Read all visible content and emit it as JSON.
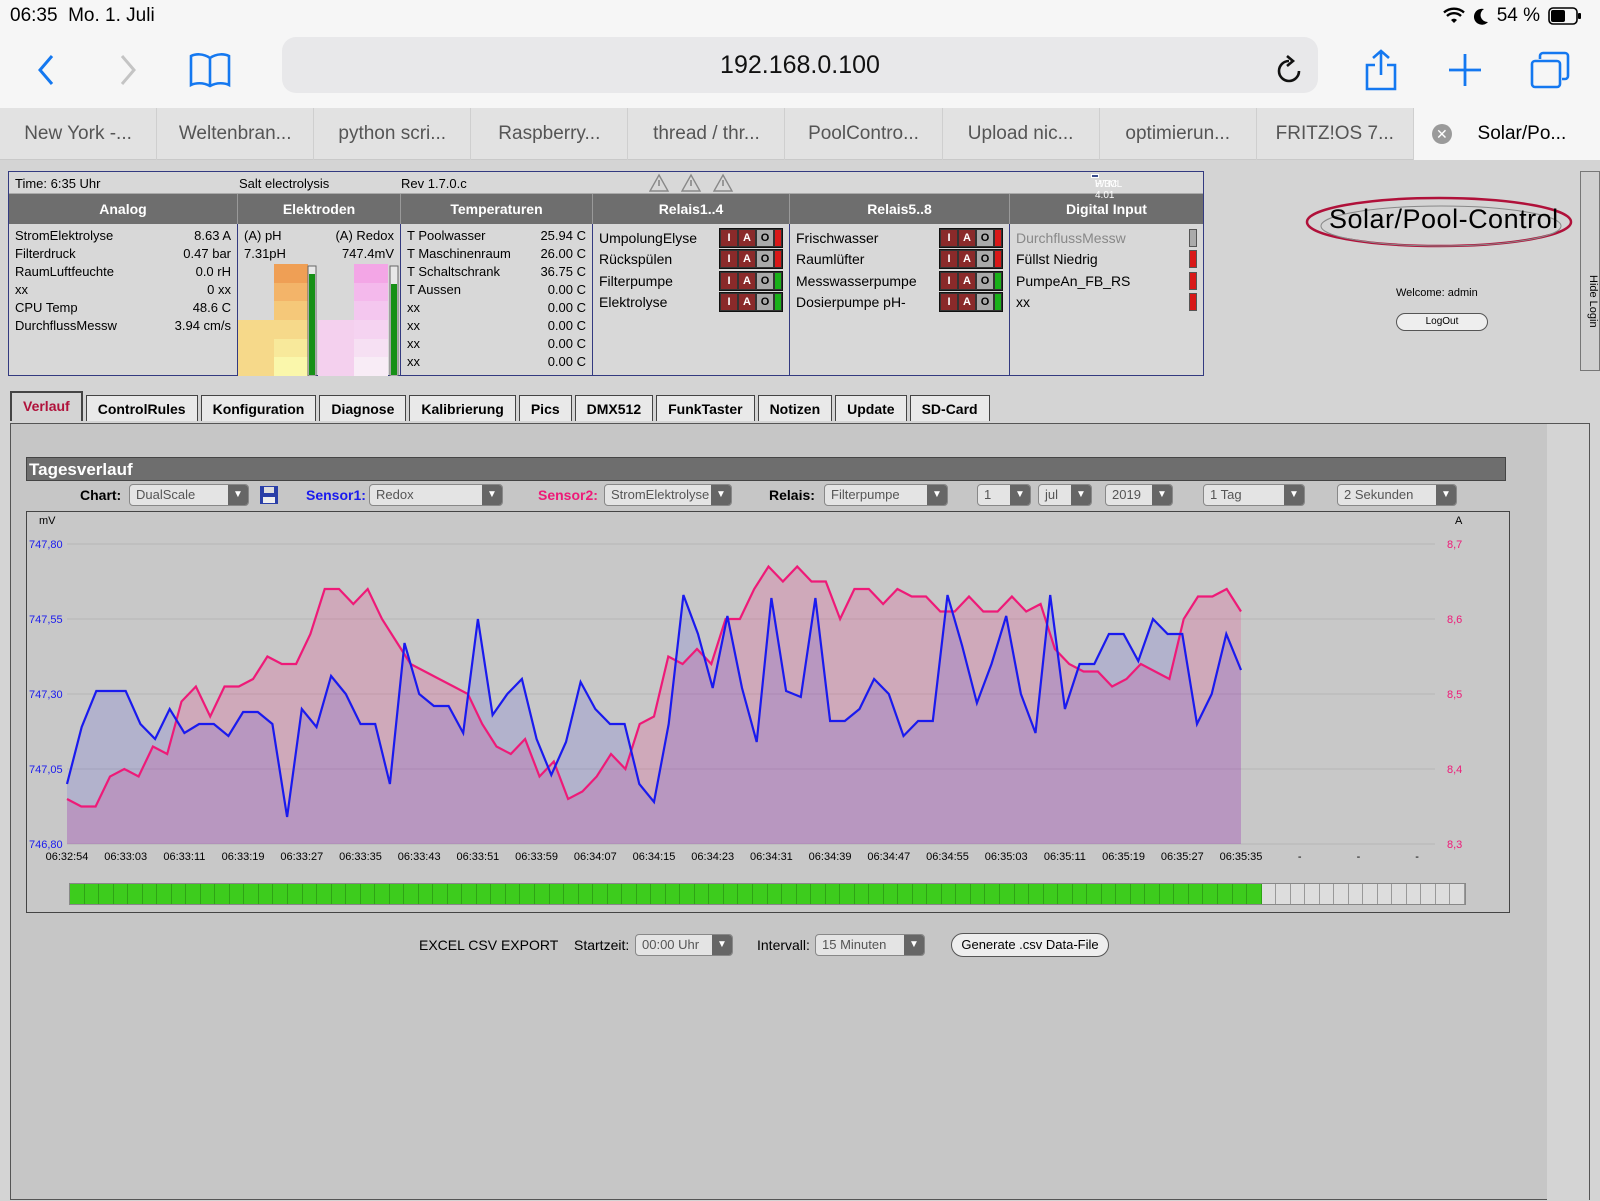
{
  "statusbar": {
    "time": "06:35",
    "date": "Mo. 1. Juli",
    "battery": "54 %"
  },
  "browser": {
    "url": "192.168.0.100",
    "tabs": [
      "New York -...",
      "Weltenbran...",
      "python scri...",
      "Raspberry...",
      "thread / thr...",
      "PoolContro...",
      "Upload nic...",
      "optimierun...",
      "FRITZ!OS 7...",
      "Solar/Po..."
    ]
  },
  "status": {
    "time": "Time: 6:35 Uhr",
    "mode": "Salt electrolysis",
    "rev": "Rev 1.7.0.c",
    "badge": "HTML 4.01",
    "badge_prefix": "W3C",
    "headers": [
      "Analog",
      "Elektroden",
      "Temperaturen",
      "Relais1..4",
      "Relais5..8",
      "Digital Input"
    ],
    "analog": [
      {
        "name": "StromElektrolyse",
        "value": "8.63 A"
      },
      {
        "name": "Filterdruck",
        "value": "0.47 bar"
      },
      {
        "name": "RaumLuftfeuchte",
        "value": "0.0 rH"
      },
      {
        "name": "xx",
        "value": "0 xx"
      },
      {
        "name": "CPU Temp",
        "value": "48.6 C"
      },
      {
        "name": "DurchflussMessw",
        "value": "3.94 cm/s"
      }
    ],
    "elektroden": {
      "ph_label": "(A) pH",
      "redox_label": "(A) Redox",
      "ph_value": "7.31pH",
      "redox_value": "747.4mV"
    },
    "temperaturen": [
      {
        "name": "T Poolwasser",
        "value": "25.94 C"
      },
      {
        "name": "T Maschinenraum",
        "value": "26.00 C"
      },
      {
        "name": "T Schaltschrank",
        "value": "36.75 C"
      },
      {
        "name": "T Aussen",
        "value": "0.00 C"
      },
      {
        "name": "xx",
        "value": "0.00 C"
      },
      {
        "name": "xx",
        "value": "0.00 C"
      },
      {
        "name": "xx",
        "value": "0.00 C"
      },
      {
        "name": "xx",
        "value": "0.00 C"
      }
    ],
    "relais14": [
      "UmpolungElyse",
      "Rückspülen",
      "Filterpumpe",
      "Elektrolyse"
    ],
    "relais14_state": [
      "red",
      "red",
      "green",
      "green"
    ],
    "relais58": [
      "Frischwasser",
      "Raumlüfter",
      "Messwasserpumpe",
      "Dosierpumpe pH-"
    ],
    "relais58_state": [
      "red",
      "red",
      "green",
      "green"
    ],
    "iao": [
      "I",
      "A",
      "O"
    ],
    "digital": [
      {
        "name": "DurchflussMessw",
        "state": "grey"
      },
      {
        "name": "Füllst Niedrig",
        "state": "red"
      },
      {
        "name": "PumpeAn_FB_RS",
        "state": "red"
      },
      {
        "name": "xx",
        "state": "red"
      }
    ]
  },
  "logo": "Solar/Pool-Control",
  "welcome": "Welcome:  admin",
  "logout": "LogOut",
  "hide_login": "Hide Login",
  "tabs": [
    "Verlauf",
    "ControlRules",
    "Konfiguration",
    "Diagnose",
    "Kalibrierung",
    "Pics",
    "DMX512",
    "FunkTaster",
    "Notizen",
    "Update",
    "SD-Card"
  ],
  "tagesverlauf": {
    "title": "Tagesverlauf",
    "chart_label": "Chart:",
    "chart_value": "DualScale",
    "sensor1_label": "Sensor1:",
    "sensor1_value": "Redox",
    "sensor2_label": "Sensor2:",
    "sensor2_value": "StromElektrolyse",
    "relais_label": "Relais:",
    "relais_value": "Filterpumpe",
    "day": "1",
    "month": "jul",
    "year": "2019",
    "range": "1 Tag",
    "interval": "2 Sekunden"
  },
  "colors": {
    "sensor1": "#1a1aee",
    "sensor2": "#ee1a78",
    "accent": "#b0113a"
  },
  "chart_data": {
    "type": "line",
    "y1_unit": "mV",
    "y2_unit": "A",
    "y1_ticks": [
      "747,80",
      "747,55",
      "747,30",
      "747,05",
      "746,80"
    ],
    "y2_ticks": [
      "8,7",
      "8,6",
      "8,5",
      "8,4",
      "8,3"
    ],
    "y1lim": [
      746.8,
      747.8
    ],
    "y2lim": [
      8.3,
      8.7
    ],
    "x_ticks": [
      "06:32:54",
      "06:33:03",
      "06:33:11",
      "06:33:19",
      "06:33:27",
      "06:33:35",
      "06:33:43",
      "06:33:51",
      "06:33:59",
      "06:34:07",
      "06:34:15",
      "06:34:23",
      "06:34:31",
      "06:34:39",
      "06:34:47",
      "06:34:55",
      "06:35:03",
      "06:35:11",
      "06:35:19",
      "06:35:27",
      "06:35:35",
      "-",
      "-",
      "-"
    ],
    "series": [
      {
        "axis": "y1",
        "values": [
          747.0,
          747.19,
          747.31,
          747.31,
          747.31,
          747.2,
          747.15,
          747.25,
          747.17,
          747.2,
          747.2,
          747.16,
          747.24,
          747.24,
          747.2,
          746.89,
          747.25,
          747.19,
          747.36,
          747.3,
          747.2,
          747.2,
          747.0,
          747.47,
          747.3,
          747.26,
          747.26,
          747.17,
          747.55,
          747.23,
          747.3,
          747.35,
          747.15,
          747.03,
          747.14,
          747.34,
          747.25,
          747.2,
          747.2,
          747.0,
          746.94,
          747.2,
          747.63,
          747.5,
          747.32,
          747.56,
          747.32,
          747.14,
          747.62,
          747.31,
          747.29,
          747.62,
          747.21,
          747.21,
          747.25,
          747.35,
          747.3,
          747.16,
          747.21,
          747.21,
          747.63,
          747.46,
          747.27,
          747.4,
          747.56,
          747.3,
          747.17,
          747.63,
          747.25,
          747.4,
          747.4,
          747.5,
          747.5,
          747.41,
          747.55,
          747.5,
          747.5,
          747.2,
          747.3,
          747.5,
          747.38
        ]
      },
      {
        "axis": "y2",
        "values": [
          8.36,
          8.35,
          8.35,
          8.39,
          8.4,
          8.39,
          8.43,
          8.42,
          8.49,
          8.51,
          8.47,
          8.51,
          8.51,
          8.52,
          8.55,
          8.54,
          8.54,
          8.58,
          8.64,
          8.64,
          8.62,
          8.64,
          8.6,
          8.57,
          8.54,
          8.53,
          8.52,
          8.51,
          8.5,
          8.46,
          8.43,
          8.42,
          8.44,
          8.39,
          8.41,
          8.36,
          8.37,
          8.39,
          8.42,
          8.4,
          8.46,
          8.47,
          8.55,
          8.54,
          8.56,
          8.54,
          8.6,
          8.6,
          8.64,
          8.67,
          8.65,
          8.67,
          8.65,
          8.65,
          8.6,
          8.64,
          8.64,
          8.62,
          8.64,
          8.63,
          8.63,
          8.61,
          8.61,
          8.63,
          8.61,
          8.61,
          8.63,
          8.61,
          8.62,
          8.56,
          8.54,
          8.53,
          8.53,
          8.51,
          8.52,
          8.54,
          8.53,
          8.52,
          8.6,
          8.63,
          8.63,
          8.64,
          8.61
        ]
      }
    ],
    "progress_done": 1,
    "progress_total": 1
  },
  "progress": {
    "filled": 82,
    "total": 96
  },
  "export": {
    "label": "EXCEL CSV EXPORT",
    "start_label": "Startzeit:",
    "start_value": "00:00 Uhr",
    "interval_label": "Intervall:",
    "interval_value": "15 Minuten",
    "button": "Generate .csv Data-File"
  }
}
